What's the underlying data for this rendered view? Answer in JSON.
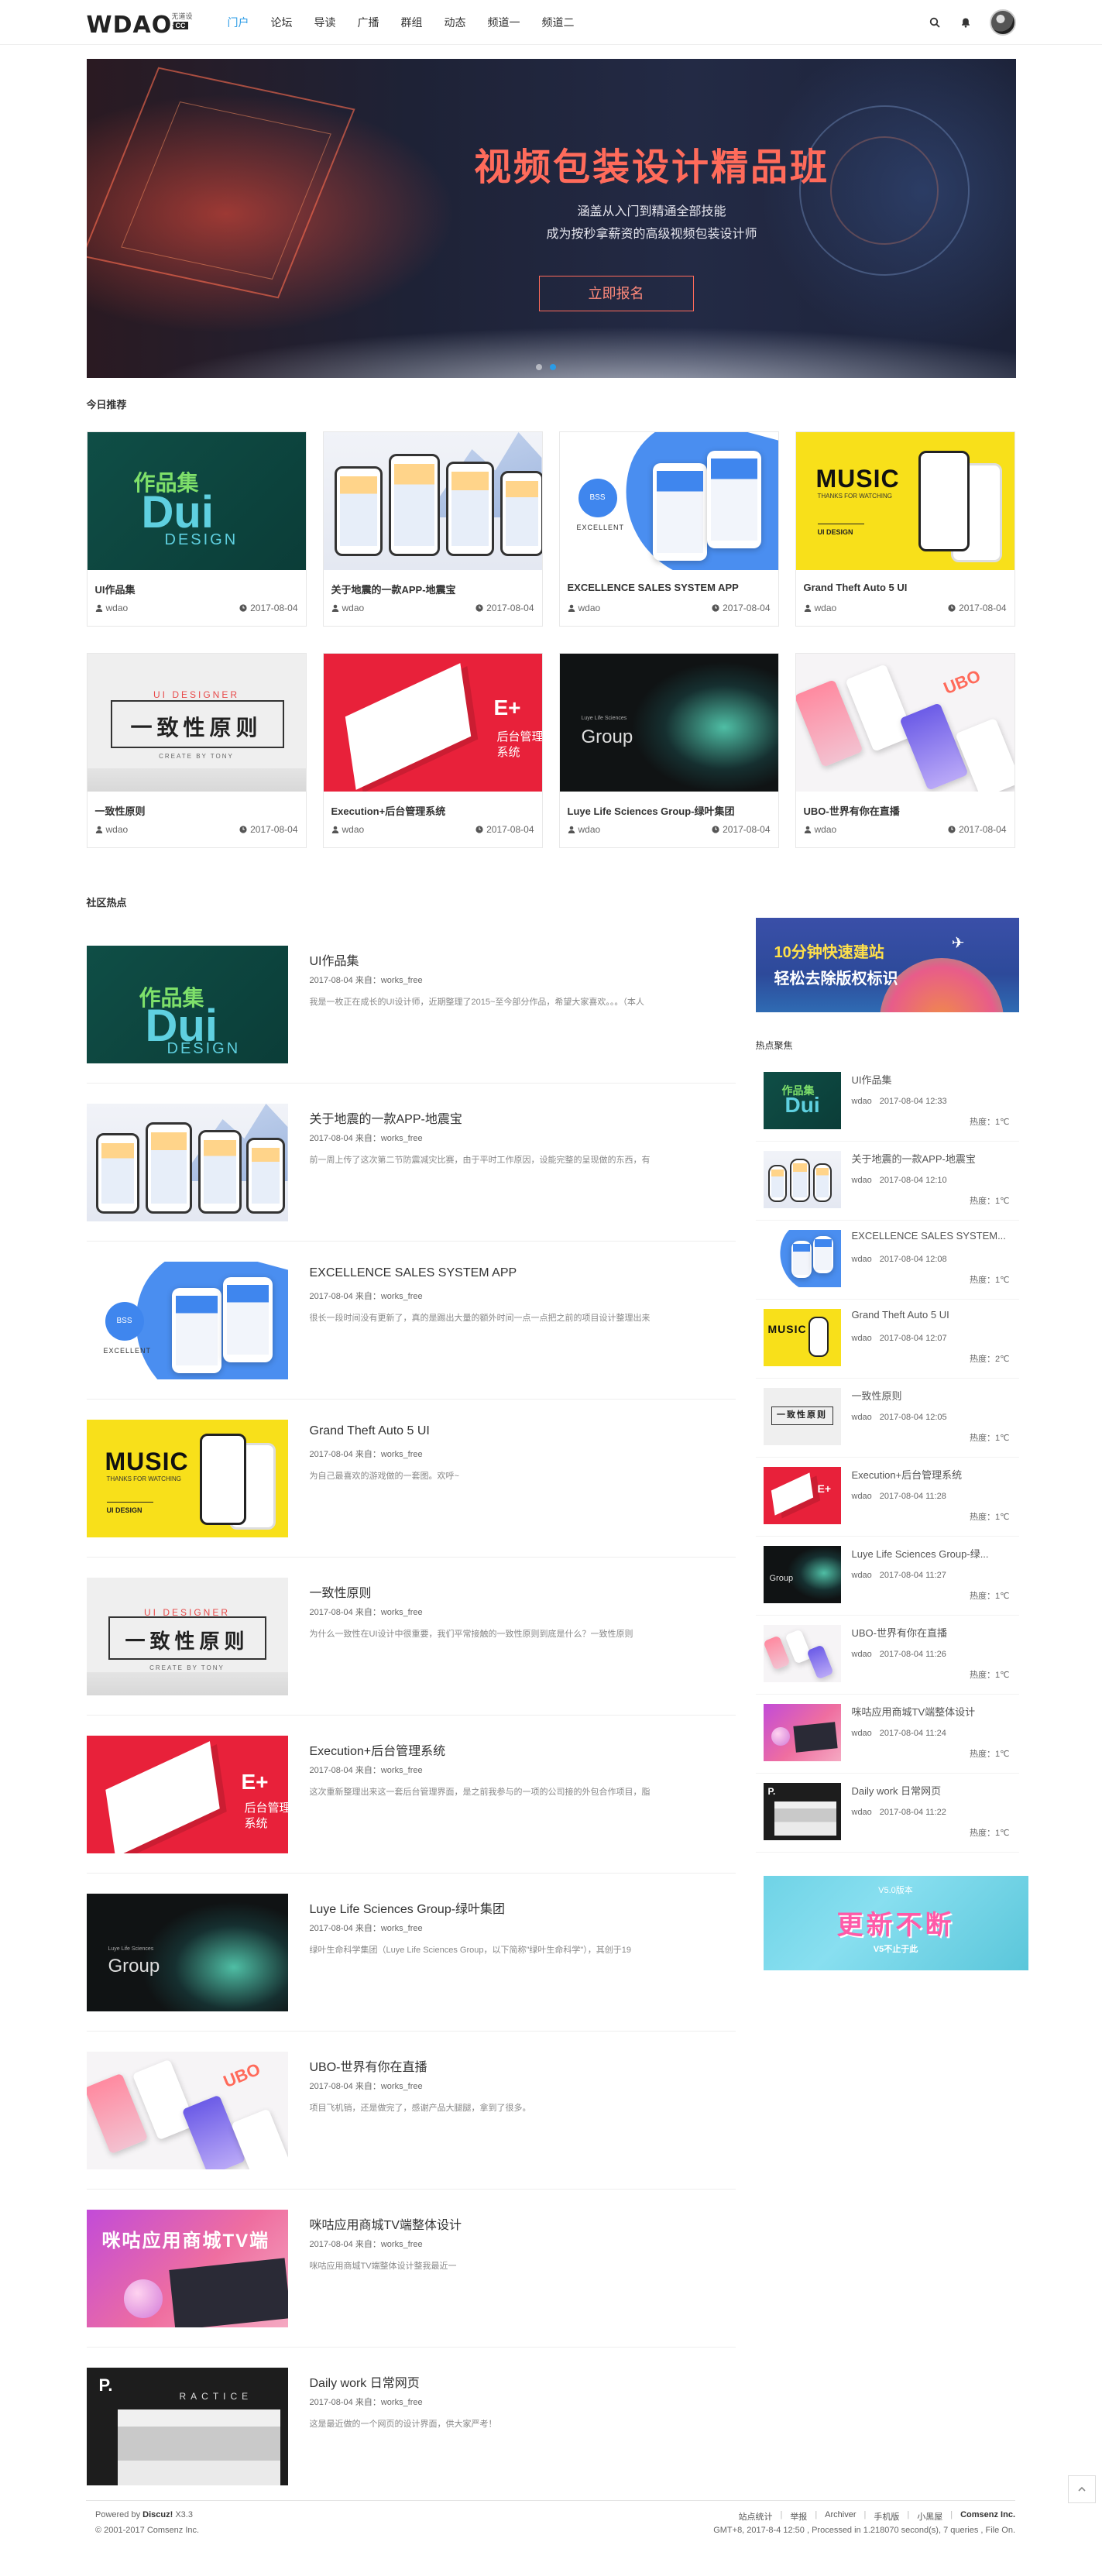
{
  "header": {
    "logo_text": "WDAO",
    "logo_tag": "无道设计",
    "logo_badge": "CC",
    "nav": [
      "门户",
      "论坛",
      "导读",
      "广播",
      "群组",
      "动态",
      "频道一",
      "频道二"
    ],
    "active_nav": "门户",
    "icons": [
      "search-icon",
      "bell-icon"
    ]
  },
  "banner": {
    "title": "视频包装设计精品班",
    "subtitle_1": "涵盖从入门到精通全部技能",
    "subtitle_2": "成为按秒拿薪资的高级视频包装设计师",
    "button": "立即报名",
    "slide_count": 2,
    "active_slide": 2
  },
  "recommend": {
    "title": "今日推荐",
    "items": [
      {
        "title": "UI作品集",
        "author": "wdao",
        "date": "2017-08-04"
      },
      {
        "title": "关于地震的一款APP-地震宝",
        "author": "wdao",
        "date": "2017-08-04"
      },
      {
        "title": "EXCELLENCE SALES SYSTEM APP",
        "author": "wdao",
        "date": "2017-08-04"
      },
      {
        "title": "Grand Theft Auto 5 UI",
        "author": "wdao",
        "date": "2017-08-04"
      },
      {
        "title": "一致性原则",
        "author": "wdao",
        "date": "2017-08-04"
      },
      {
        "title": "Execution+后台管理系统",
        "author": "wdao",
        "date": "2017-08-04"
      },
      {
        "title": "Luye Life Sciences Group-绿叶集团",
        "author": "wdao",
        "date": "2017-08-04"
      },
      {
        "title": "UBO-世界有你在直播",
        "author": "wdao",
        "date": "2017-08-04"
      }
    ]
  },
  "thumb_text": {
    "dui_1": "作品集",
    "dui_2": "Dui",
    "dui_3": "DESIGN",
    "excel_bubble": "BSS",
    "excel_label": "EXCELLENT",
    "music_1": "MUSIC",
    "music_2": "THANKS FOR WATCHING",
    "music_3": "UI DESIGN",
    "ui_top": "UI DESIGNER",
    "ui_mid": "一致性原则",
    "ui_bot": "CREATE BY TONY",
    "exec_1": "E+",
    "exec_2": "后台管理系统",
    "luye_small": "Luye Life Sciences",
    "luye_big": "Group",
    "ubo_logo": "UBO",
    "migu": "咪咕应用商城TV端",
    "daily_p": "P.",
    "daily_rac": "RACTICE"
  },
  "community": {
    "title": "社区热点",
    "items": [
      {
        "title": "UI作品集",
        "date": "2017-08-04",
        "source_label": "来自：",
        "source": "works_free",
        "desc": "我是一枚正在成长的UI设计师，近期整理了2015~至今部分作品，希望大家喜欢。。。（本人"
      },
      {
        "title": "关于地震的一款APP-地震宝",
        "date": "2017-08-04",
        "source_label": "来自：",
        "source": "works_free",
        "desc": "前一周上传了这次第二节防震减灾比赛，由于平时工作原因，设能完整的呈现做的东西，有"
      },
      {
        "title": "EXCELLENCE SALES SYSTEM APP",
        "date": "2017-08-04",
        "source_label": "来自：",
        "source": "works_free",
        "desc": "很长一段时间没有更新了，真的是踢出大量的额外时间一点一点把之前的项目设计整理出来"
      },
      {
        "title": "Grand Theft Auto 5 UI",
        "date": "2017-08-04",
        "source_label": "来自：",
        "source": "works_free",
        "desc": "为自己最喜欢的游戏做的一套图。欢呼~"
      },
      {
        "title": "一致性原则",
        "date": "2017-08-04",
        "source_label": "来自：",
        "source": "works_free",
        "desc": "为什么一致性在UI设计中很重要，我们平常接触的一致性原则到底是什么？一致性原则"
      },
      {
        "title": "Execution+后台管理系统",
        "date": "2017-08-04",
        "source_label": "来自：",
        "source": "works_free",
        "desc": "这次重新整理出来这一套后台管理界面，是之前我参与的一项的公司接的外包合作项目，脂"
      },
      {
        "title": "Luye Life Sciences Group-绿叶集团",
        "date": "2017-08-04",
        "source_label": "来自：",
        "source": "works_free",
        "desc": "绿叶生命科学集团（Luye Life Sciences Group，以下简称\"绿叶生命科学\"），其创于19"
      },
      {
        "title": "UBO-世界有你在直播",
        "date": "2017-08-04",
        "source_label": "来自：",
        "source": "works_free",
        "desc": "项目飞机销，还是做完了，感谢产品大腿腿，拿到了很多。"
      },
      {
        "title": "咪咕应用商城TV端整体设计",
        "date": "2017-08-04",
        "source_label": "来自：",
        "source": "works_free",
        "desc": "咪咕应用商城TV端整体设计整我最近一"
      },
      {
        "title": "Daily work 日常网页",
        "date": "2017-08-04",
        "source_label": "来自：",
        "source": "works_free",
        "desc": "这是最近做的一个网页的设计界面，供大家严考！"
      }
    ]
  },
  "sidebar": {
    "ad_top_1": "10分钟快速建站",
    "ad_top_2": "轻松去除版权标识",
    "title": "热点聚焦",
    "heat_label": "热度：",
    "items": [
      {
        "title": "UI作品集",
        "author": "wdao",
        "time": "2017-08-04 12:33",
        "heat": "1℃"
      },
      {
        "title": "关于地震的一款APP-地震宝",
        "author": "wdao",
        "time": "2017-08-04 12:10",
        "heat": "1℃"
      },
      {
        "title": "EXCELLENCE SALES SYSTEM...",
        "author": "wdao",
        "time": "2017-08-04 12:08",
        "heat": "1℃"
      },
      {
        "title": "Grand Theft Auto 5 UI",
        "author": "wdao",
        "time": "2017-08-04 12:07",
        "heat": "2℃"
      },
      {
        "title": "一致性原则",
        "author": "wdao",
        "time": "2017-08-04 12:05",
        "heat": "1℃"
      },
      {
        "title": "Execution+后台管理系统",
        "author": "wdao",
        "time": "2017-08-04 11:28",
        "heat": "1℃"
      },
      {
        "title": "Luye Life Sciences Group-绿...",
        "author": "wdao",
        "time": "2017-08-04 11:27",
        "heat": "1℃"
      },
      {
        "title": "UBO-世界有你在直播",
        "author": "wdao",
        "time": "2017-08-04 11:26",
        "heat": "1℃"
      },
      {
        "title": "咪咕应用商城TV端整体设计",
        "author": "wdao",
        "time": "2017-08-04 11:24",
        "heat": "1℃"
      },
      {
        "title": "Daily work 日常网页",
        "author": "wdao",
        "time": "2017-08-04 11:22",
        "heat": "1℃"
      }
    ],
    "ad_bottom_top": "V5.0版本",
    "ad_bottom_main": "更新不断",
    "ad_bottom_sub": "V5不止于此"
  },
  "footer": {
    "powered_prefix": "Powered by",
    "powered_brand": "Discuz!",
    "powered_version": "X3.3",
    "copyright": "© 2001-2017 Comsenz Inc.",
    "links": [
      "站点统计",
      "举报",
      "Archiver",
      "手机版",
      "小黑屋",
      "Comsenz Inc."
    ],
    "stats": "GMT+8, 2017-8-4 12:50 , Processed in 1.218070 second(s), 7 queries , File On."
  }
}
